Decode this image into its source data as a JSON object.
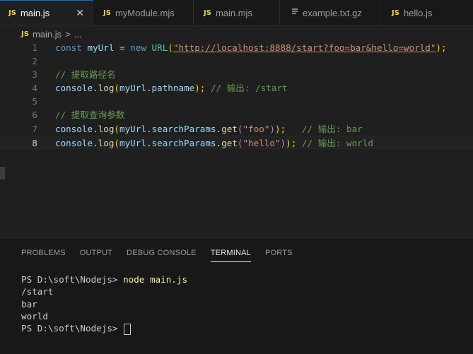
{
  "tabs": [
    {
      "label": "main.js",
      "icon": "js-icon",
      "active": true
    },
    {
      "label": "myModule.mjs",
      "icon": "js-icon"
    },
    {
      "label": "main.mjs",
      "icon": "js-icon"
    },
    {
      "label": "example.txt.gz",
      "icon": "file-lines-icon"
    },
    {
      "label": "hello.js",
      "icon": "js-icon"
    }
  ],
  "close_glyph": "✕",
  "js_badge": "JS",
  "breadcrumb": {
    "file": "main.js",
    "separator": ">",
    "symbol": "..."
  },
  "editor": {
    "line_numbers": [
      "1",
      "2",
      "3",
      "4",
      "5",
      "6",
      "7",
      "8"
    ],
    "line1": {
      "kw_const": "const",
      "var": "myUrl",
      "eq": " = ",
      "kw_new": "new",
      "cls": "URL",
      "open": "(",
      "url": "\"http://localhost:8888/start?foo=bar&hello=world\"",
      "close": ");"
    },
    "line3": {
      "comment": "// 提取路径名"
    },
    "line4": {
      "obj": "console",
      "dot": ".",
      "fn": "log",
      "open": "(",
      "var": "myUrl",
      "dot2": ".",
      "prop": "pathname",
      "close": ");",
      "comment": " // 输出: /start"
    },
    "line6": {
      "comment": "// 提取查询参数"
    },
    "line7": {
      "obj": "console",
      "dot": ".",
      "fn": "log",
      "open": "(",
      "var": "myUrl",
      "dot2": ".",
      "prop": "searchParams",
      "dot3": ".",
      "fn2": "get",
      "open2": "(",
      "str": "\"foo\"",
      "close2": ")",
      "close": ");",
      "comment": "   // 输出: bar"
    },
    "line8": {
      "obj": "console",
      "dot": ".",
      "fn": "log",
      "open": "(",
      "var": "myUrl",
      "dot2": ".",
      "prop": "searchParams",
      "dot3": ".",
      "fn2": "get",
      "open2": "(",
      "str": "\"hello\"",
      "close2": ")",
      "close": ");",
      "comment": " // 输出: world"
    }
  },
  "panel": {
    "tabs": [
      "PROBLEMS",
      "OUTPUT",
      "DEBUG CONSOLE",
      "TERMINAL",
      "PORTS"
    ],
    "active_tab": "TERMINAL"
  },
  "terminal": {
    "prompt": "PS D:\\soft\\Nodejs> ",
    "command": "node main.js",
    "output": [
      "/start",
      "bar",
      "world"
    ],
    "prompt2": "PS D:\\soft\\Nodejs> "
  },
  "colors": {
    "accent": "#0078d4",
    "background": "#1f1f1f",
    "js_badge": "#e8d44d"
  }
}
